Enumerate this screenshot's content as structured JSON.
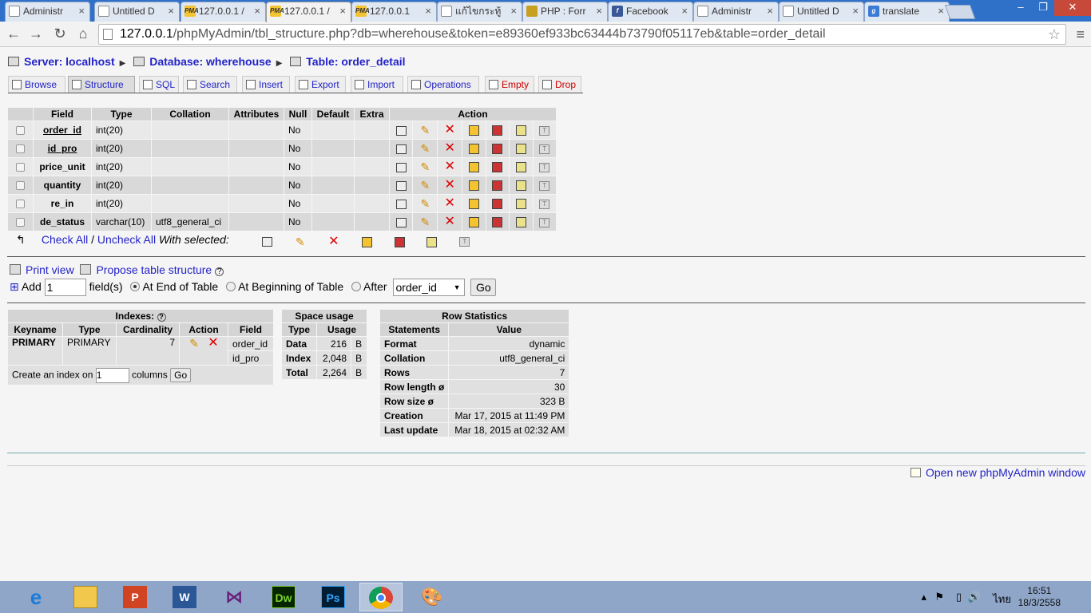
{
  "browser": {
    "tabs": [
      {
        "label": "Administr",
        "icon": "doc-icon"
      },
      {
        "label": "Untitled D",
        "icon": "doc-icon"
      },
      {
        "label": "127.0.0.1 /",
        "icon": "pma-icon"
      },
      {
        "label": "127.0.0.1 /",
        "icon": "pma-icon"
      },
      {
        "label": "127.0.0.1",
        "icon": "pma-icon"
      },
      {
        "label": "แก้ไขกระทู้",
        "icon": "doc-icon"
      },
      {
        "label": "PHP : Forr",
        "icon": "lock-icon"
      },
      {
        "label": "Facebook",
        "icon": "facebook-icon"
      },
      {
        "label": "Administr",
        "icon": "doc-icon"
      },
      {
        "label": "Untitled D",
        "icon": "doc-icon"
      },
      {
        "label": "translate",
        "icon": "google-icon"
      }
    ],
    "url_host": "127.0.0.1",
    "url_rest": "/phpMyAdmin/tbl_structure.php?db=wherehouse&token=e89360ef933bc63444b73790f05117eb&table=order_detail"
  },
  "breadcrumb": {
    "server": "Server: localhost",
    "database": "Database: wherehouse",
    "table": "Table: order_detail"
  },
  "db_tabs": [
    "Browse",
    "Structure",
    "SQL",
    "Search",
    "Insert",
    "Export",
    "Import",
    "Operations",
    "Empty",
    "Drop"
  ],
  "structure": {
    "headers": [
      "Field",
      "Type",
      "Collation",
      "Attributes",
      "Null",
      "Default",
      "Extra",
      "Action"
    ],
    "rows": [
      {
        "field": "order_id",
        "type": "int(20)",
        "collation": "",
        "attributes": "",
        "null": "No",
        "default": "",
        "extra": ""
      },
      {
        "field": "id_pro",
        "type": "int(20)",
        "collation": "",
        "attributes": "",
        "null": "No",
        "default": "",
        "extra": ""
      },
      {
        "field": "price_unit",
        "type": "int(20)",
        "collation": "",
        "attributes": "",
        "null": "No",
        "default": "",
        "extra": ""
      },
      {
        "field": "quantity",
        "type": "int(20)",
        "collation": "",
        "attributes": "",
        "null": "No",
        "default": "",
        "extra": ""
      },
      {
        "field": "re_in",
        "type": "int(20)",
        "collation": "",
        "attributes": "",
        "null": "No",
        "default": "",
        "extra": ""
      },
      {
        "field": "de_status",
        "type": "varchar(10)",
        "collation": "utf8_general_ci",
        "attributes": "",
        "null": "No",
        "default": "",
        "extra": ""
      }
    ],
    "check_all": "Check All",
    "slash": "/",
    "uncheck_all": "Uncheck All",
    "with_selected": "With selected:"
  },
  "links": {
    "print_view": "Print view",
    "propose": "Propose table structure"
  },
  "add_fields": {
    "add": "Add",
    "count": "1",
    "fields_label": "field(s)",
    "at_end": "At End of Table",
    "at_beginning": "At Beginning of Table",
    "after": "After",
    "after_value": "order_id",
    "go": "Go"
  },
  "indexes": {
    "title": "Indexes:",
    "headers": [
      "Keyname",
      "Type",
      "Cardinality",
      "Action",
      "Field"
    ],
    "row": {
      "keyname": "PRIMARY",
      "type": "PRIMARY",
      "cardinality": "7",
      "fields": [
        "order_id",
        "id_pro"
      ]
    },
    "create_label": "Create an index on",
    "create_count": "1",
    "columns_label": "columns",
    "go": "Go"
  },
  "space_usage": {
    "title": "Space usage",
    "headers": [
      "Type",
      "Usage"
    ],
    "rows": [
      {
        "type": "Data",
        "value": "216",
        "unit": "B"
      },
      {
        "type": "Index",
        "value": "2,048",
        "unit": "B"
      },
      {
        "type": "Total",
        "value": "2,264",
        "unit": "B"
      }
    ]
  },
  "row_stats": {
    "title": "Row Statistics",
    "headers": [
      "Statements",
      "Value"
    ],
    "rows": [
      {
        "k": "Format",
        "v": "dynamic"
      },
      {
        "k": "Collation",
        "v": "utf8_general_ci"
      },
      {
        "k": "Rows",
        "v": "7"
      },
      {
        "k": "Row length ø",
        "v": "30"
      },
      {
        "k": "Row size ø",
        "v": "323 B"
      },
      {
        "k": "Creation",
        "v": "Mar 17, 2015 at 11:49 PM"
      },
      {
        "k": "Last update",
        "v": "Mar 18, 2015 at 02:32 AM"
      }
    ]
  },
  "open_new": "Open new phpMyAdmin window",
  "taskbar": {
    "apps": [
      "ie-icon",
      "explorer-icon",
      "powerpoint-icon",
      "word-icon",
      "visual-studio-icon",
      "dreamweaver-icon",
      "photoshop-icon",
      "chrome-icon",
      "paint-icon"
    ],
    "dw_label": "Dw",
    "ps_label": "Ps",
    "lang": "ไทย",
    "time": "16:51",
    "date": "18/3/2558"
  }
}
